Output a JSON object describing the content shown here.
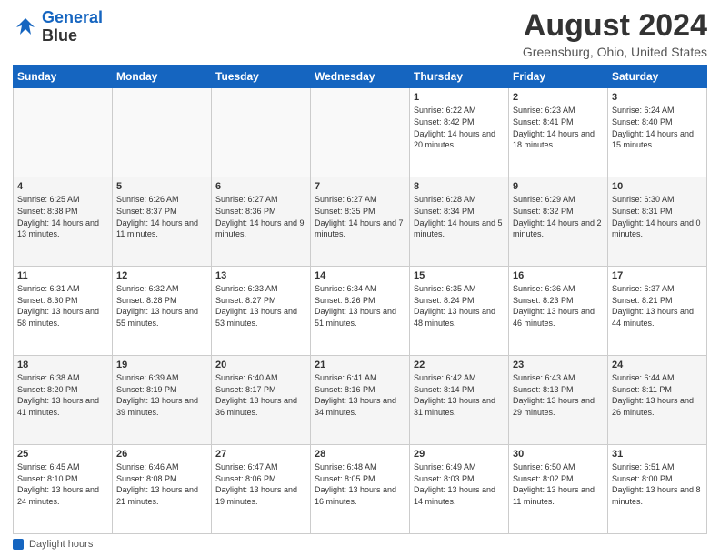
{
  "header": {
    "logo_line1": "General",
    "logo_line2": "Blue",
    "month_year": "August 2024",
    "location": "Greensburg, Ohio, United States"
  },
  "footer": {
    "label": "Daylight hours"
  },
  "days_of_week": [
    "Sunday",
    "Monday",
    "Tuesday",
    "Wednesday",
    "Thursday",
    "Friday",
    "Saturday"
  ],
  "weeks": [
    [
      {
        "num": "",
        "info": ""
      },
      {
        "num": "",
        "info": ""
      },
      {
        "num": "",
        "info": ""
      },
      {
        "num": "",
        "info": ""
      },
      {
        "num": "1",
        "info": "Sunrise: 6:22 AM\nSunset: 8:42 PM\nDaylight: 14 hours and 20 minutes."
      },
      {
        "num": "2",
        "info": "Sunrise: 6:23 AM\nSunset: 8:41 PM\nDaylight: 14 hours and 18 minutes."
      },
      {
        "num": "3",
        "info": "Sunrise: 6:24 AM\nSunset: 8:40 PM\nDaylight: 14 hours and 15 minutes."
      }
    ],
    [
      {
        "num": "4",
        "info": "Sunrise: 6:25 AM\nSunset: 8:38 PM\nDaylight: 14 hours and 13 minutes."
      },
      {
        "num": "5",
        "info": "Sunrise: 6:26 AM\nSunset: 8:37 PM\nDaylight: 14 hours and 11 minutes."
      },
      {
        "num": "6",
        "info": "Sunrise: 6:27 AM\nSunset: 8:36 PM\nDaylight: 14 hours and 9 minutes."
      },
      {
        "num": "7",
        "info": "Sunrise: 6:27 AM\nSunset: 8:35 PM\nDaylight: 14 hours and 7 minutes."
      },
      {
        "num": "8",
        "info": "Sunrise: 6:28 AM\nSunset: 8:34 PM\nDaylight: 14 hours and 5 minutes."
      },
      {
        "num": "9",
        "info": "Sunrise: 6:29 AM\nSunset: 8:32 PM\nDaylight: 14 hours and 2 minutes."
      },
      {
        "num": "10",
        "info": "Sunrise: 6:30 AM\nSunset: 8:31 PM\nDaylight: 14 hours and 0 minutes."
      }
    ],
    [
      {
        "num": "11",
        "info": "Sunrise: 6:31 AM\nSunset: 8:30 PM\nDaylight: 13 hours and 58 minutes."
      },
      {
        "num": "12",
        "info": "Sunrise: 6:32 AM\nSunset: 8:28 PM\nDaylight: 13 hours and 55 minutes."
      },
      {
        "num": "13",
        "info": "Sunrise: 6:33 AM\nSunset: 8:27 PM\nDaylight: 13 hours and 53 minutes."
      },
      {
        "num": "14",
        "info": "Sunrise: 6:34 AM\nSunset: 8:26 PM\nDaylight: 13 hours and 51 minutes."
      },
      {
        "num": "15",
        "info": "Sunrise: 6:35 AM\nSunset: 8:24 PM\nDaylight: 13 hours and 48 minutes."
      },
      {
        "num": "16",
        "info": "Sunrise: 6:36 AM\nSunset: 8:23 PM\nDaylight: 13 hours and 46 minutes."
      },
      {
        "num": "17",
        "info": "Sunrise: 6:37 AM\nSunset: 8:21 PM\nDaylight: 13 hours and 44 minutes."
      }
    ],
    [
      {
        "num": "18",
        "info": "Sunrise: 6:38 AM\nSunset: 8:20 PM\nDaylight: 13 hours and 41 minutes."
      },
      {
        "num": "19",
        "info": "Sunrise: 6:39 AM\nSunset: 8:19 PM\nDaylight: 13 hours and 39 minutes."
      },
      {
        "num": "20",
        "info": "Sunrise: 6:40 AM\nSunset: 8:17 PM\nDaylight: 13 hours and 36 minutes."
      },
      {
        "num": "21",
        "info": "Sunrise: 6:41 AM\nSunset: 8:16 PM\nDaylight: 13 hours and 34 minutes."
      },
      {
        "num": "22",
        "info": "Sunrise: 6:42 AM\nSunset: 8:14 PM\nDaylight: 13 hours and 31 minutes."
      },
      {
        "num": "23",
        "info": "Sunrise: 6:43 AM\nSunset: 8:13 PM\nDaylight: 13 hours and 29 minutes."
      },
      {
        "num": "24",
        "info": "Sunrise: 6:44 AM\nSunset: 8:11 PM\nDaylight: 13 hours and 26 minutes."
      }
    ],
    [
      {
        "num": "25",
        "info": "Sunrise: 6:45 AM\nSunset: 8:10 PM\nDaylight: 13 hours and 24 minutes."
      },
      {
        "num": "26",
        "info": "Sunrise: 6:46 AM\nSunset: 8:08 PM\nDaylight: 13 hours and 21 minutes."
      },
      {
        "num": "27",
        "info": "Sunrise: 6:47 AM\nSunset: 8:06 PM\nDaylight: 13 hours and 19 minutes."
      },
      {
        "num": "28",
        "info": "Sunrise: 6:48 AM\nSunset: 8:05 PM\nDaylight: 13 hours and 16 minutes."
      },
      {
        "num": "29",
        "info": "Sunrise: 6:49 AM\nSunset: 8:03 PM\nDaylight: 13 hours and 14 minutes."
      },
      {
        "num": "30",
        "info": "Sunrise: 6:50 AM\nSunset: 8:02 PM\nDaylight: 13 hours and 11 minutes."
      },
      {
        "num": "31",
        "info": "Sunrise: 6:51 AM\nSunset: 8:00 PM\nDaylight: 13 hours and 8 minutes."
      }
    ]
  ]
}
